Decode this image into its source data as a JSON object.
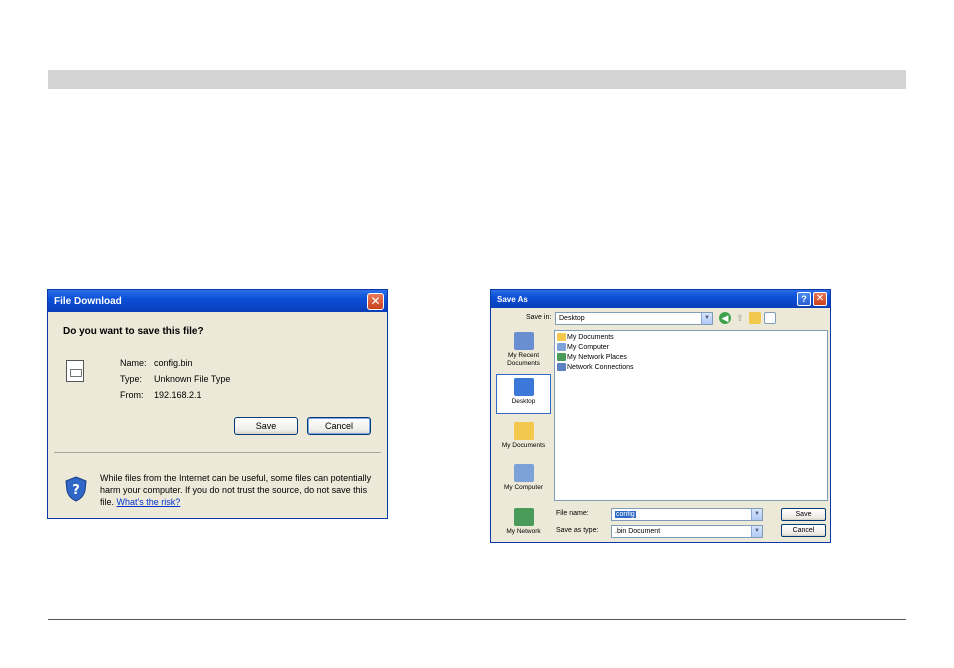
{
  "file_download": {
    "title": "File Download",
    "close_glyph": "✕",
    "question": "Do you want to save this file?",
    "file_icon": "document-icon",
    "name_label": "Name:",
    "name_value": "config.bin",
    "type_label": "Type:",
    "type_value": "Unknown File Type",
    "from_label": "From:",
    "from_value": "192.168.2.1",
    "save_label": "Save",
    "cancel_label": "Cancel",
    "warning_text": "While files from the Internet can be useful, some files can potentially harm your computer. If you do not trust the source, do not save this file.",
    "risk_link": "What's the risk?"
  },
  "save_as": {
    "title": "Save As",
    "help_glyph": "?",
    "close_glyph": "✕",
    "save_in_label": "Save in:",
    "save_in_value": "Desktop",
    "places": [
      {
        "label": "My Recent Documents",
        "icon": "recent-documents-icon",
        "color": "#6a8fd0"
      },
      {
        "label": "Desktop",
        "icon": "desktop-icon",
        "color": "#3c78d8"
      },
      {
        "label": "My Documents",
        "icon": "folder-icon",
        "color": "#f2c94c"
      },
      {
        "label": "My Computer",
        "icon": "computer-icon",
        "color": "#7da2d8"
      },
      {
        "label": "My Network",
        "icon": "network-icon",
        "color": "#4a9a5a"
      }
    ],
    "files": [
      {
        "label": "My Documents",
        "color": "#f2c94c"
      },
      {
        "label": "My Computer",
        "color": "#7da2d8"
      },
      {
        "label": "My Network Places",
        "color": "#4a9a5a"
      },
      {
        "label": "Network Connections",
        "color": "#5b7fc0"
      }
    ],
    "file_name_label": "File name:",
    "file_name_value": "config",
    "save_as_type_label": "Save as type:",
    "save_as_type_value": ".bin Document",
    "save_label": "Save",
    "cancel_label": "Cancel"
  }
}
